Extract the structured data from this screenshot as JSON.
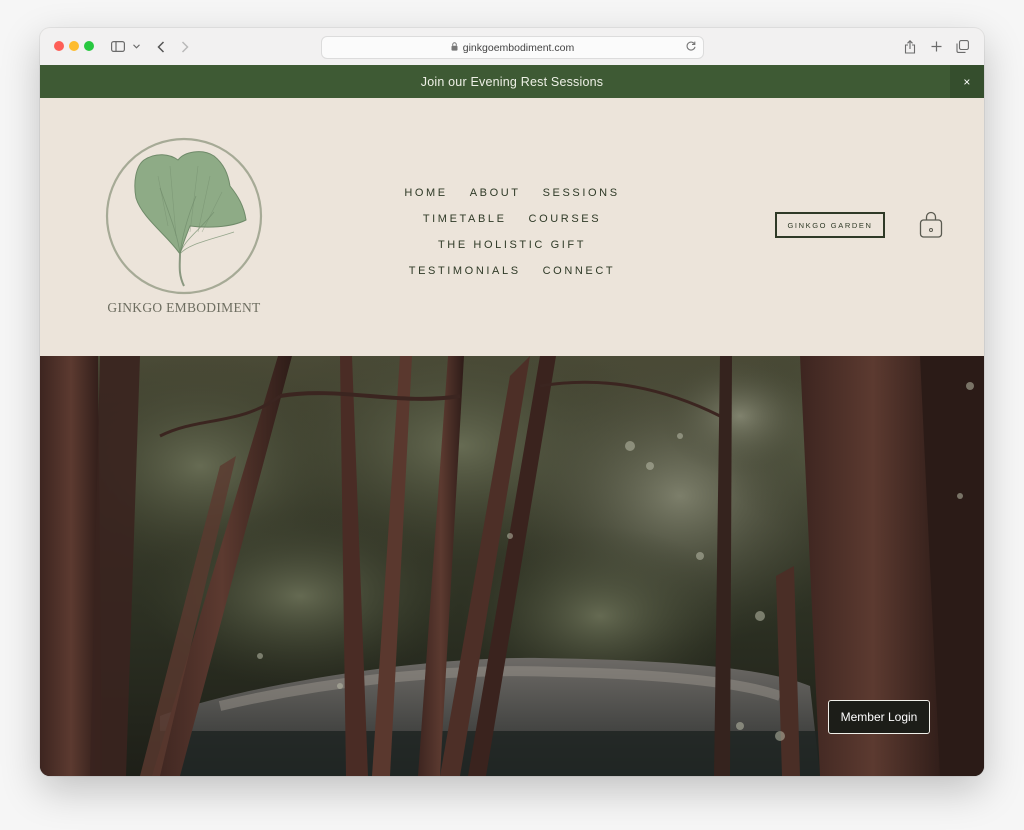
{
  "browser": {
    "url": "ginkgoembodiment.com"
  },
  "announcement": {
    "text": "Join our Evening Rest Sessions",
    "close_label": "×"
  },
  "brand": {
    "name": "GINKGO EMBODIMENT"
  },
  "nav": {
    "rows": [
      [
        "HOME",
        "ABOUT",
        "SESSIONS"
      ],
      [
        "TIMETABLE",
        "COURSES"
      ],
      [
        "THE HOLISTIC GIFT"
      ],
      [
        "TESTIMONIALS",
        "CONNECT"
      ]
    ]
  },
  "header_actions": {
    "garden_label": "GINKGO GARDEN"
  },
  "member_login": {
    "label": "Member Login"
  },
  "colors": {
    "accent_green": "#3e5a34",
    "header_bg": "#ece4da",
    "text_dark": "#2f3a27"
  }
}
